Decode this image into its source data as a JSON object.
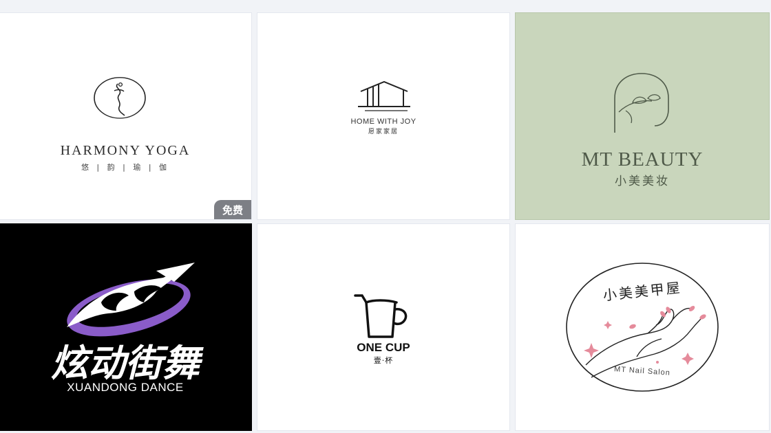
{
  "cards": [
    {
      "name_en": "HARMONY YOGA",
      "name_cn": "悠 | 韵 | 瑜 | 伽",
      "badge": "免费",
      "icon": "yoga-figure-circle"
    },
    {
      "name_en": "HOME WITH JOY",
      "name_cn": "愿家家居",
      "icon": "house-outline"
    },
    {
      "name_en": "MT BEAUTY",
      "name_cn": "小美美妆",
      "icon": "face-leaf-arch",
      "bg": "#c9d6bc"
    },
    {
      "name_en": "XUANDONG DANCE",
      "name_cn": "炫动街舞",
      "icon": "dc-swoosh",
      "bg": "#000000"
    },
    {
      "name_en": "ONE CUP",
      "name_cn": "壹·杯",
      "icon": "cup-straw"
    },
    {
      "name_en": "MT Nail Salon",
      "name_cn": "小美美甲屋",
      "icon": "hands-circle",
      "accent": "#e58b9b"
    }
  ]
}
